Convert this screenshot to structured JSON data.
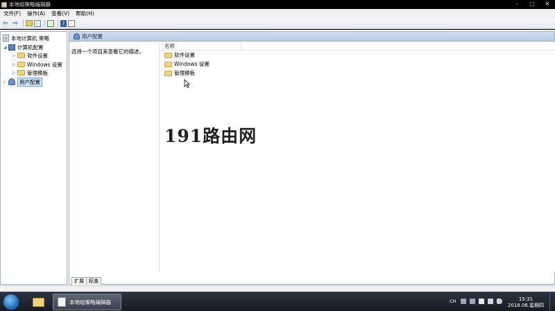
{
  "window": {
    "title": "本地组策略编辑器",
    "buttons": {
      "minimize": "–",
      "maximize": "□",
      "close": "✕"
    }
  },
  "menu": {
    "items": [
      "文件(F)",
      "操作(A)",
      "查看(V)",
      "帮助(H)"
    ]
  },
  "toolbar": {
    "back": "⇦",
    "forward": "⇨",
    "help": "?"
  },
  "tree": {
    "root": "本地计算机 策略",
    "computer": "计算机配置",
    "computer_children": [
      "软件设置",
      "Windows 设置",
      "管理模板"
    ],
    "user": "用户配置"
  },
  "right_pane": {
    "header": "用户配置",
    "description": "选择一个项目来查看它的描述。",
    "column_name": "名称",
    "items": [
      "软件设置",
      "Windows 设置",
      "管理模板"
    ],
    "tabs": [
      "扩展",
      "标准"
    ]
  },
  "watermark": "191路由网",
  "taskbar": {
    "active_app": "本地组策略编辑器",
    "tray_lang": "CH",
    "time": "15:31",
    "date": "2018.06.星期四"
  }
}
